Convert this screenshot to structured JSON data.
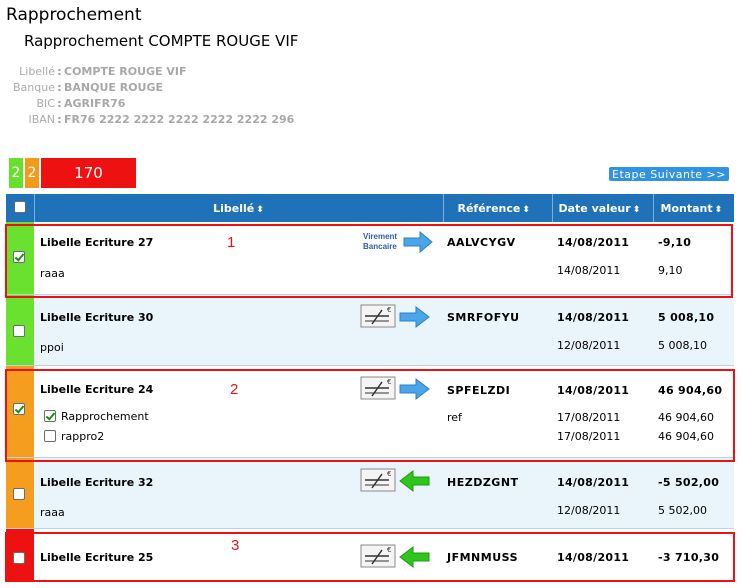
{
  "app": {
    "title": "Rapprochement"
  },
  "page": {
    "subtitle": "Rapprochement COMPTE ROUGE VIF"
  },
  "account": [
    {
      "label": "Libellé",
      "value": "COMPTE ROUGE VIF"
    },
    {
      "label": "Banque",
      "value": "BANQUE ROUGE"
    },
    {
      "label": "BIC",
      "value": "AGRIFR76"
    },
    {
      "label": "IBAN",
      "value": "FR76 2222 2222 2222 2222 2222 296"
    }
  ],
  "counters": {
    "green": "2",
    "orange": "2",
    "red": "170"
  },
  "next_button": "Etape Suivante >>",
  "table": {
    "columns": [
      "Libellé",
      "Référence",
      "Date valeur",
      "Montant"
    ],
    "sort_glyph": "⬍",
    "rows": [
      {
        "status": "green",
        "checked": true,
        "title": "Libelle Ecriture 27",
        "icon": "virement-bancaire-icon",
        "icon_text_1": "Virement",
        "icon_text_2": "Bancaire",
        "direction": "right",
        "sub": "raaa",
        "ref": "AALVCYGV",
        "ref_sub": "",
        "date": "14/08/2011",
        "date_sub": "14/08/2011",
        "amount": "-9,10",
        "amount_sub": "9,10"
      },
      {
        "status": "green",
        "checked": false,
        "title": "Libelle Ecriture 30",
        "icon": "cheque-icon",
        "direction": "right",
        "sub": "ppoi",
        "ref": "SMRFOFYU",
        "ref_sub": "",
        "date": "14/08/2011",
        "date_sub": "12/08/2011",
        "amount": "5 008,10",
        "amount_sub": "5 008,10"
      },
      {
        "status": "orange",
        "checked": true,
        "title": "Libelle Ecriture 24",
        "icon": "cheque-icon",
        "direction": "right",
        "options": [
          {
            "label": "Rapprochement",
            "checked": true
          },
          {
            "label": "rappro2",
            "checked": false
          }
        ],
        "ref": "SPFELZDI",
        "ref_sub": "ref",
        "date": "14/08/2011",
        "date_sub": "17/08/2011",
        "date_sub2": "17/08/2011",
        "amount": "46 904,60",
        "amount_sub": "46 904,60",
        "amount_sub2": "46 904,60"
      },
      {
        "status": "orange",
        "checked": false,
        "title": "Libelle Ecriture 32",
        "icon": "cheque-icon",
        "direction": "left",
        "sub": "raaa",
        "ref": "HEZDZGNT",
        "ref_sub": "",
        "date": "14/08/2011",
        "date_sub": "12/08/2011",
        "amount": "-5 502,00",
        "amount_sub": "5 502,00"
      },
      {
        "status": "red",
        "checked": false,
        "title": "Libelle Ecriture 25",
        "icon": "cheque-icon",
        "direction": "left",
        "ref": "JFMNMUSS",
        "date": "14/08/2011",
        "amount": "-3 710,30"
      }
    ]
  },
  "annotations": [
    "1",
    "2",
    "3"
  ],
  "colors": {
    "header": "#1f72b8",
    "green": "#6ae12e",
    "orange": "#f59d1f",
    "red": "#ee1111",
    "highlight": "#ee1111",
    "arrow_right": "#3b9de4",
    "arrow_left": "#2ec51d"
  }
}
